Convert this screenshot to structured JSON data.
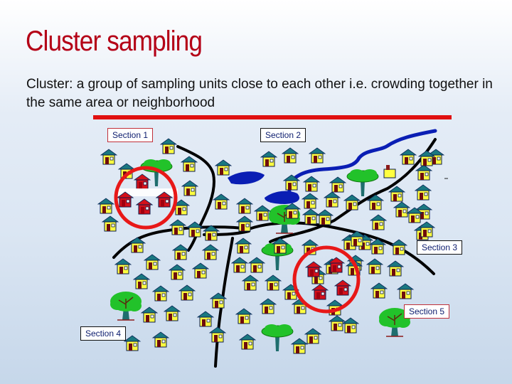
{
  "slide": {
    "title": "Cluster sampling",
    "description": "Cluster: a group of sampling units close to each other i.e. crowding together in the same area or neighborhood"
  },
  "diagram": {
    "sections": [
      {
        "id": "section-1",
        "label": "Section 1",
        "border": "#c0303a"
      },
      {
        "id": "section-2",
        "label": "Section 2",
        "border": "#111111"
      },
      {
        "id": "section-3",
        "label": "Section 3",
        "border": "#111111"
      },
      {
        "id": "section-4",
        "label": "Section 4",
        "border": "#111111"
      },
      {
        "id": "section-5",
        "label": "Section 5",
        "border": "#c0303a"
      }
    ],
    "selected_clusters": [
      "Section 1",
      "Section 5"
    ],
    "legend_colors": {
      "selected_house": "#d4101a",
      "house_wall": "#ffff40",
      "house_roof": "#1a7880",
      "door": "#6e0c0c",
      "river": "#0a1eb4",
      "road": "#000000",
      "cluster_circle": "#e81818",
      "tree_foliage": "#22c22a",
      "tree_trunk": "#1f6e6e"
    }
  }
}
